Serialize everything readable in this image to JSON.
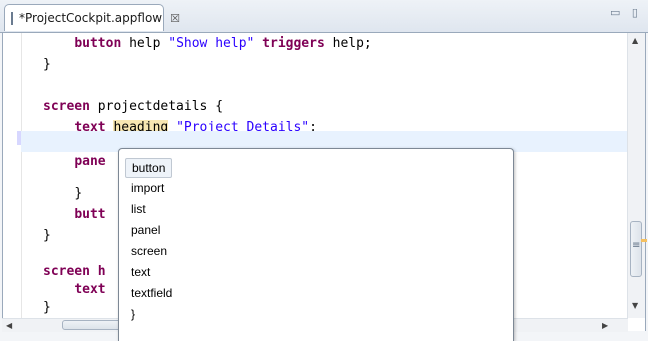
{
  "tab": {
    "title": "*ProjectCockpit.appflow",
    "close": "☒"
  },
  "window_controls": "▭ ▯",
  "code_lines": [
    {
      "indent": "    ",
      "parts": [
        [
          "kw",
          "button"
        ],
        [
          "",
          "help "
        ],
        [
          "str",
          "\"Show help\""
        ],
        [
          "",
          ""
        ],
        [
          "kw",
          "triggers"
        ],
        [
          "",
          "help;"
        ]
      ]
    }
  ],
  "editor": {
    "lines": {
      "l1_a": "button",
      "l1_b": " help ",
      "l1_c": "\"Show help\"",
      "l1_d": " ",
      "l1_e": "triggers",
      "l1_f": " help;",
      "l2": "}",
      "l4_a": "screen",
      "l4_b": " projectdetails {",
      "l5_a": "text",
      "l5_b": "heading",
      "l5_c": "\"Project Details\"",
      "l5_d": ";",
      "l7": "pane",
      "l9": "}",
      "l10": "butt",
      "l11": "}",
      "l13": "screen h",
      "l14": "text",
      "l15": "}"
    }
  },
  "completion": {
    "items": [
      "button",
      "import",
      "list",
      "panel",
      "screen",
      "text",
      "textfield",
      "}"
    ],
    "selected_index": 0
  }
}
